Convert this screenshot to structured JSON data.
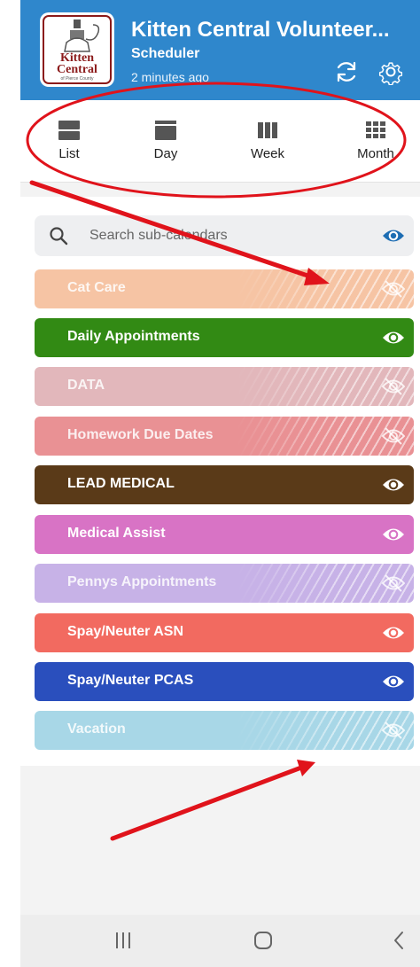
{
  "header": {
    "title": "Kitten Central Volunteer...",
    "subtitle": "Scheduler",
    "updated": "2 minutes ago",
    "logo_text_1": "Kitten",
    "logo_text_2": "Central",
    "logo_text_3": "of Pierce County",
    "color": "#2f87cc"
  },
  "views": [
    {
      "label": "List",
      "icon": "list-view-icon"
    },
    {
      "label": "Day",
      "icon": "day-view-icon"
    },
    {
      "label": "Week",
      "icon": "week-view-icon"
    },
    {
      "label": "Month",
      "icon": "month-view-icon"
    }
  ],
  "search": {
    "placeholder": "Search sub-calendars"
  },
  "calendars": [
    {
      "label": "Cat Care",
      "color": "#f6c4a4",
      "visible": false
    },
    {
      "label": "Daily Appointments",
      "color": "#328a14",
      "visible": true
    },
    {
      "label": "DATA",
      "color": "#e2b7bb",
      "visible": false
    },
    {
      "label": "Homework Due Dates",
      "color": "#e99194",
      "visible": false
    },
    {
      "label": "LEAD MEDICAL",
      "color": "#5a3a18",
      "visible": true
    },
    {
      "label": "Medical Assist",
      "color": "#d873c5",
      "visible": true
    },
    {
      "label": "Pennys Appointments",
      "color": "#c7b2e7",
      "visible": false
    },
    {
      "label": "Spay/Neuter ASN",
      "color": "#f26a60",
      "visible": true
    },
    {
      "label": "Spay/Neuter PCAS",
      "color": "#2a4fbd",
      "visible": true
    },
    {
      "label": "Vacation",
      "color": "#a8d7e7",
      "visible": false
    }
  ],
  "nav": [
    "recents-icon",
    "home-icon",
    "back-icon"
  ]
}
